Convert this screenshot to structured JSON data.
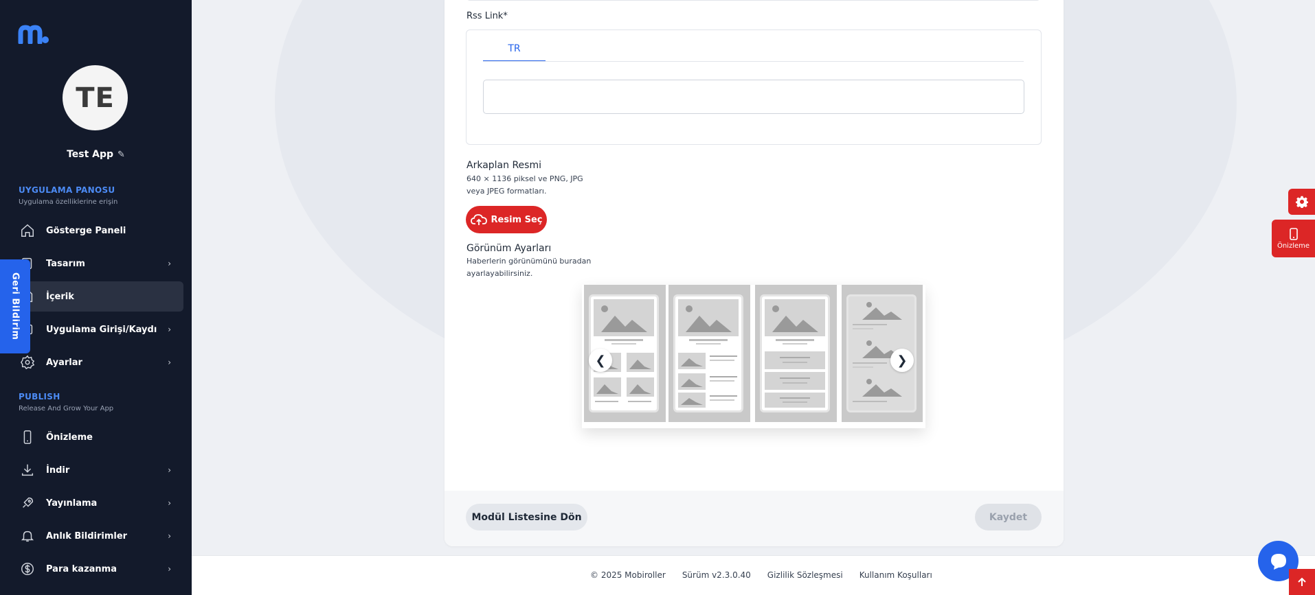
{
  "sidebar": {
    "avatar_initials": "TE",
    "app_name": "Test App",
    "section1": {
      "title": "UYGULAMA PANOSU",
      "subtitle": "Uygulama özelliklerine erişin"
    },
    "section2": {
      "title": "PUBLISH",
      "subtitle": "Release And Grow Your App"
    },
    "items": [
      {
        "label": "Gösterge Paneli",
        "icon": "home-icon"
      },
      {
        "label": "Tasarım",
        "icon": "design-icon"
      },
      {
        "label": "İçerik",
        "icon": "content-icon"
      },
      {
        "label": "Uygulama Girişi/Kaydı",
        "icon": "login-icon"
      },
      {
        "label": "Ayarlar",
        "icon": "gear-icon"
      },
      {
        "label": "Önizleme",
        "icon": "phone-icon"
      },
      {
        "label": "İndir",
        "icon": "download-icon"
      },
      {
        "label": "Yayınlama",
        "icon": "rocket-icon"
      },
      {
        "label": "Anlık Bildirimler",
        "icon": "bell-icon"
      },
      {
        "label": "Para kazanma",
        "icon": "dollar-icon"
      }
    ],
    "feedback_label": "Geri Bildirim"
  },
  "form": {
    "rss_label": "Rss Link*",
    "rss_tab": "TR",
    "rss_value": "",
    "background": {
      "label": "Arkaplan Resmi",
      "description": "640 × 1136 piksel ve PNG, JPG veya JPEG formatları.",
      "upload_label": "Resim Seç"
    },
    "view": {
      "label": "Görünüm Ayarları",
      "description": "Haberlerin görünümünü buradan ayarlayabilirsiniz."
    },
    "carousel": {
      "prev": "❮",
      "next": "❯"
    },
    "back_button": "Modül Listesine Dön",
    "save_button": "Kaydet"
  },
  "footer": {
    "copyright": "© 2025 Mobiroller",
    "version": "Sürüm v2.3.0.40",
    "privacy": "Gizlilik Sözleşmesi",
    "terms": "Kullanım Koşulları"
  },
  "floating": {
    "preview_label": "Önizleme"
  },
  "colors": {
    "sidebar_bg": "#131a2b",
    "accent_blue": "#2563eb",
    "accent_red": "#dc2626"
  }
}
